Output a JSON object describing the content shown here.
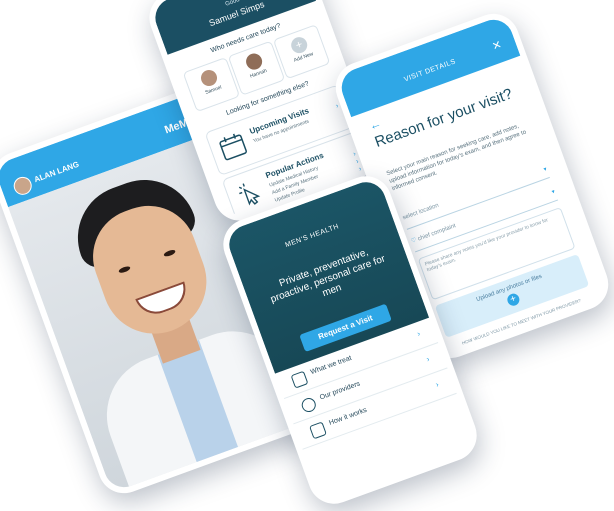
{
  "video": {
    "caller_name": "ALAN LANG",
    "logo": "MeMD"
  },
  "care": {
    "greeting": "Good",
    "patient_name": "Samuel Simps",
    "question": "Who needs care today?",
    "people": [
      {
        "name": "Samuel"
      },
      {
        "name": "Hannah"
      },
      {
        "name": "Add New",
        "icon": "plus-icon"
      }
    ],
    "question2": "Looking for something else?",
    "upcoming": {
      "title": "Upcoming Visits",
      "subtitle": "You have no appointments",
      "icon": "calendar-icon"
    },
    "popular": {
      "title": "Popular Actions",
      "icon": "cursor-click-icon",
      "items": [
        "Update Medical History",
        "Add a Family Member",
        "Update Profile"
      ]
    }
  },
  "details": {
    "header": "VISIT DETAILS",
    "title": "Reason for your visit?",
    "description": "Select your main reason for seeking care, add notes, upload information for today's exam, and then agree to informed consent.",
    "location_placeholder": "select location",
    "complaint_placeholder": "chief complaint",
    "notes_placeholder": "Please share any notes you'd like your provider to know for today's exam.",
    "upload_label": "Upload any photos or files",
    "footer": "HOW WOULD YOU LIKE TO MEET WITH YOUR PROVIDER?"
  },
  "men": {
    "label": "MEN'S HEALTH",
    "headline": "Private, preventative, proactive, personal care for men",
    "cta": "Request a Visit",
    "items": [
      "What we treat",
      "Our providers",
      "How it works"
    ]
  },
  "colors": {
    "accent": "#2fa7e6",
    "dark_teal": "#1b4f63"
  }
}
